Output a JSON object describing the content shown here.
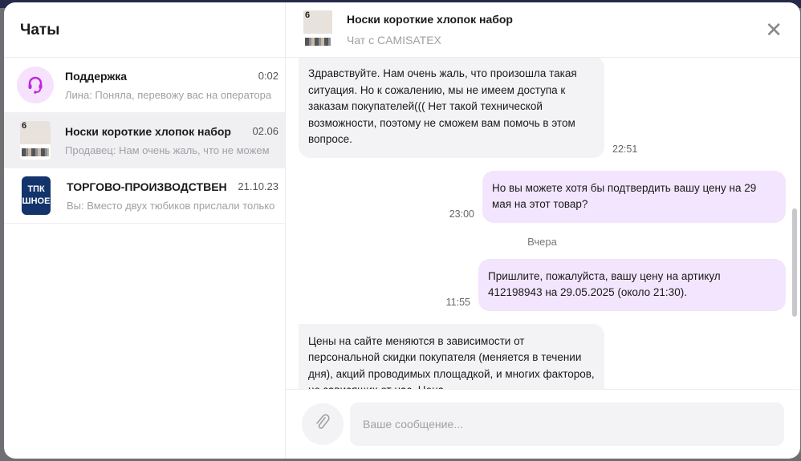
{
  "sidebar": {
    "title": "Чаты",
    "chats": [
      {
        "name": "Поддержка",
        "time": "0:02",
        "preview": "Лина: Поняла, перевожу вас на оператора"
      },
      {
        "name": "Носки короткие хлопок набор",
        "time": "02.06",
        "preview": "Продавец: Нам очень жаль, что не можем"
      },
      {
        "name": "ТОРГОВО-ПРОИЗВОДСТВЕННАЯ КОМПАНИЯ",
        "time": "21.10.23",
        "preview": "Вы: Вместо двух тюбиков прислали только",
        "logo_text": "ТПК",
        "logo_sub": "ШНОЕ"
      }
    ]
  },
  "header": {
    "title": "Носки короткие хлопок набор",
    "subtitle": "Чат с CAMISATEX",
    "product_badge": "6"
  },
  "messages": [
    {
      "dir": "in",
      "text": "Здравствуйте. Нам очень жаль, что произошла такая ситуация. Но к сожалению, мы не имеем доступа к заказам покупателей((( Нет такой технической возможности, поэтому не сможем вам помочь в этом вопросе.",
      "time": "22:51"
    },
    {
      "dir": "out",
      "text": "Но вы можете хотя бы подтвердить вашу цену на 29 мая на этот товар?",
      "time": "23:00"
    },
    {
      "divider": "Вчера"
    },
    {
      "dir": "out",
      "text": "Пришлите, пожалуйста, вашу цену на артикул 412198943 на 29.05.2025 (около 21:30).",
      "time": "11:55"
    },
    {
      "dir": "in",
      "text": "Цены на сайте меняются в зависимости от персональной скидки покупателя (меняется в течении дня), акций проводимых площадкой, и многих факторов, не зависящих от нас. Цена"
    }
  ],
  "composer": {
    "placeholder": "Ваше сообщение..."
  }
}
